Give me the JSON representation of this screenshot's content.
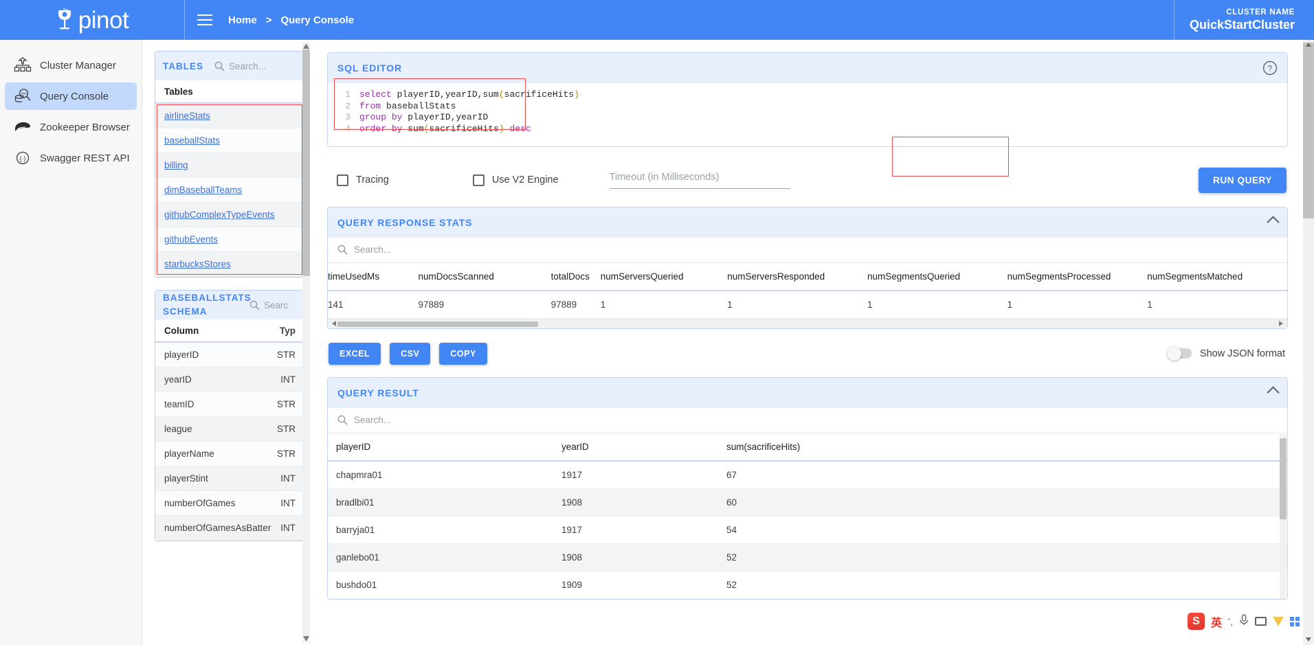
{
  "topbar": {
    "brand": "pinot",
    "menu_icon": "hamburger-icon",
    "breadcrumbs": [
      "Home",
      "Query Console"
    ],
    "separator": ">",
    "cluster_label": "CLUSTER NAME",
    "cluster_name": "QuickStartCluster",
    "accent_color": "#4285f4"
  },
  "sidebar": {
    "items": [
      {
        "label": "Cluster Manager",
        "icon": "cluster-icon",
        "active": false
      },
      {
        "label": "Query Console",
        "icon": "query-console-icon",
        "active": true
      },
      {
        "label": "Zookeeper Browser",
        "icon": "zookeeper-icon",
        "active": false
      },
      {
        "label": "Swagger REST API",
        "icon": "swagger-icon",
        "active": false
      }
    ],
    "active_bg": "#c3d9fb"
  },
  "tables_panel": {
    "title": "TABLES",
    "search_placeholder": "Search...",
    "column_header": "Tables",
    "tables": [
      "airlineStats",
      "baseballStats",
      "billing",
      "dimBaseballTeams",
      "githubComplexTypeEvents",
      "githubEvents",
      "starbucksStores"
    ],
    "highlight_color": "#ef4b4b"
  },
  "schema_panel": {
    "title": "BASEBALLSTATS SCHEMA",
    "search_placeholder": "Searc",
    "headers": [
      "Column",
      "Typ"
    ],
    "rows": [
      {
        "column": "playerID",
        "type": "STR"
      },
      {
        "column": "yearID",
        "type": "INT"
      },
      {
        "column": "teamID",
        "type": "STR"
      },
      {
        "column": "league",
        "type": "STR"
      },
      {
        "column": "playerName",
        "type": "STR"
      },
      {
        "column": "playerStint",
        "type": "INT"
      },
      {
        "column": "numberOfGames",
        "type": "INT"
      },
      {
        "column": "numberOfGamesAsBatter",
        "type": "INT"
      }
    ]
  },
  "sql_editor": {
    "title": "SQL EDITOR",
    "help_icon": "help-circle-icon",
    "lines": [
      {
        "n": "1",
        "tokens": [
          {
            "t": "select",
            "c": "kw"
          },
          {
            "t": " ",
            "c": "id"
          },
          {
            "t": "playerID,yearID,sum",
            "c": "id"
          },
          {
            "t": "(",
            "c": "par"
          },
          {
            "t": "sacrificeHits",
            "c": "id"
          },
          {
            "t": ")",
            "c": "par"
          }
        ]
      },
      {
        "n": "2",
        "tokens": [
          {
            "t": "from",
            "c": "kw"
          },
          {
            "t": " baseballStats",
            "c": "id"
          }
        ]
      },
      {
        "n": "3",
        "tokens": [
          {
            "t": "group",
            "c": "kw"
          },
          {
            "t": " ",
            "c": "id"
          },
          {
            "t": "by",
            "c": "kw"
          },
          {
            "t": " playerID,yearID",
            "c": "id"
          }
        ]
      },
      {
        "n": "4",
        "tokens": [
          {
            "t": "order",
            "c": "kw"
          },
          {
            "t": " ",
            "c": "id"
          },
          {
            "t": "by",
            "c": "kw"
          },
          {
            "t": " sum",
            "c": "id"
          },
          {
            "t": "(",
            "c": "par"
          },
          {
            "t": "sacrificeHits",
            "c": "id"
          },
          {
            "t": ")",
            "c": "par"
          },
          {
            "t": " ",
            "c": "id"
          },
          {
            "t": "desc",
            "c": "kw"
          }
        ]
      }
    ],
    "raw_query": "select playerID,yearID,sum(sacrificeHits)\nfrom baseballStats\ngroup by playerID,yearID\norder by sum(sacrificeHits) desc"
  },
  "controls": {
    "tracing_label": "Tracing",
    "tracing_checked": false,
    "v2_label": "Use V2 Engine",
    "v2_checked": false,
    "timeout_placeholder": "Timeout (in Milliseconds)",
    "timeout_value": "",
    "run_label": "RUN QUERY"
  },
  "response_stats": {
    "title": "QUERY RESPONSE STATS",
    "search_placeholder": "Search...",
    "headers": [
      "timeUsedMs",
      "numDocsScanned",
      "totalDocs",
      "numServersQueried",
      "numServersResponded",
      "numSegmentsQueried",
      "numSegmentsProcessed",
      "numSegmentsMatched"
    ],
    "rows": [
      [
        "141",
        "97889",
        "97889",
        "1",
        "1",
        "1",
        "1",
        "1"
      ]
    ]
  },
  "export": {
    "excel_label": "EXCEL",
    "csv_label": "CSV",
    "copy_label": "COPY",
    "toggle_label": "Show JSON format",
    "toggle_on": false
  },
  "query_result": {
    "title": "QUERY RESULT",
    "search_placeholder": "Search...",
    "headers": [
      "playerID",
      "yearID",
      "sum(sacrificeHits)"
    ],
    "rows": [
      [
        "chapmra01",
        "1917",
        "67"
      ],
      [
        "bradlbi01",
        "1908",
        "60"
      ],
      [
        "barryja01",
        "1917",
        "54"
      ],
      [
        "ganlebo01",
        "1908",
        "52"
      ],
      [
        "bushdo01",
        "1909",
        "52"
      ]
    ]
  },
  "ime": {
    "logo": "S",
    "lang": "英",
    "punct": "ʻ,",
    "mic": "mic-icon",
    "keyboard": "keyboard-icon",
    "toolbox": "toolbox-icon",
    "apps": "apps-icon"
  }
}
